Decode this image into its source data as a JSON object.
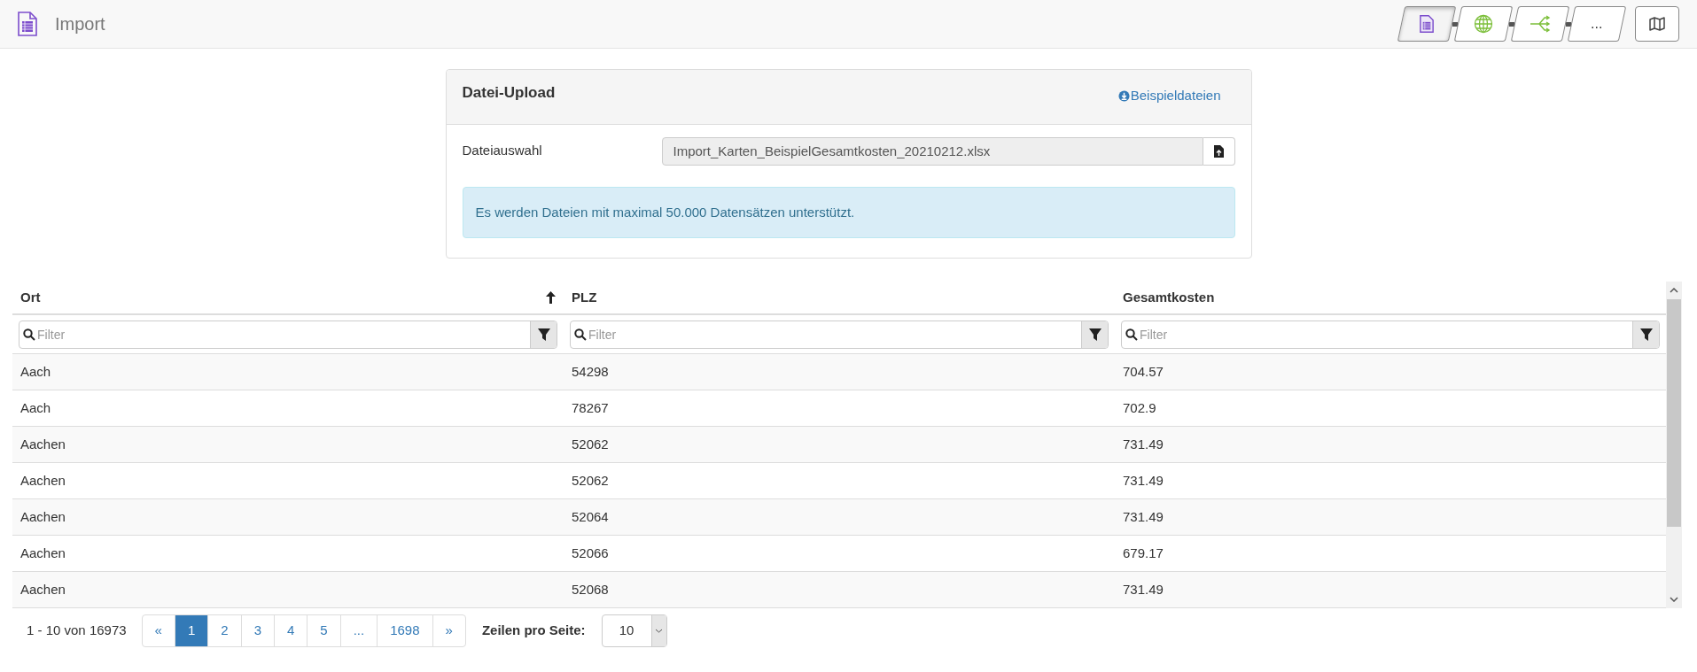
{
  "header": {
    "title": "Import",
    "steps": [
      {
        "kind": "table",
        "selected": true
      },
      {
        "kind": "globe",
        "selected": false
      },
      {
        "kind": "branch",
        "selected": false
      },
      {
        "kind": "text",
        "label": "...",
        "selected": false
      }
    ]
  },
  "upload": {
    "title": "Datei-Upload",
    "examples_link": "Beispieldateien",
    "file_label": "Dateiauswahl",
    "file_value": "Import_Karten_BeispielGesamtkosten_20210212.xlsx",
    "info": "Es werden Dateien mit maximal 50.000 Datensätzen unterstützt."
  },
  "table": {
    "columns": [
      {
        "label": "Ort",
        "sorted": true,
        "filter_placeholder": "Filter"
      },
      {
        "label": "PLZ",
        "sorted": false,
        "filter_placeholder": "Filter"
      },
      {
        "label": "Gesamtkosten",
        "sorted": false,
        "filter_placeholder": "Filter"
      }
    ],
    "rows": [
      [
        "Aach",
        "54298",
        "704.57"
      ],
      [
        "Aach",
        "78267",
        "702.9"
      ],
      [
        "Aachen",
        "52062",
        "731.49"
      ],
      [
        "Aachen",
        "52062",
        "731.49"
      ],
      [
        "Aachen",
        "52064",
        "731.49"
      ],
      [
        "Aachen",
        "52066",
        "679.17"
      ],
      [
        "Aachen",
        "52068",
        "731.49"
      ]
    ]
  },
  "pagination": {
    "summary": "1 - 10 von 16973",
    "pages": [
      {
        "label": "«",
        "selected": false
      },
      {
        "label": "1",
        "selected": true
      },
      {
        "label": "2",
        "selected": false
      },
      {
        "label": "3",
        "selected": false
      },
      {
        "label": "4",
        "selected": false
      },
      {
        "label": "5",
        "selected": false
      },
      {
        "label": "...",
        "selected": false
      },
      {
        "label": "1698",
        "selected": false
      },
      {
        "label": "»",
        "selected": false
      }
    ],
    "rows_label": "Zeilen pro Seite:",
    "rows_value": "10"
  }
}
